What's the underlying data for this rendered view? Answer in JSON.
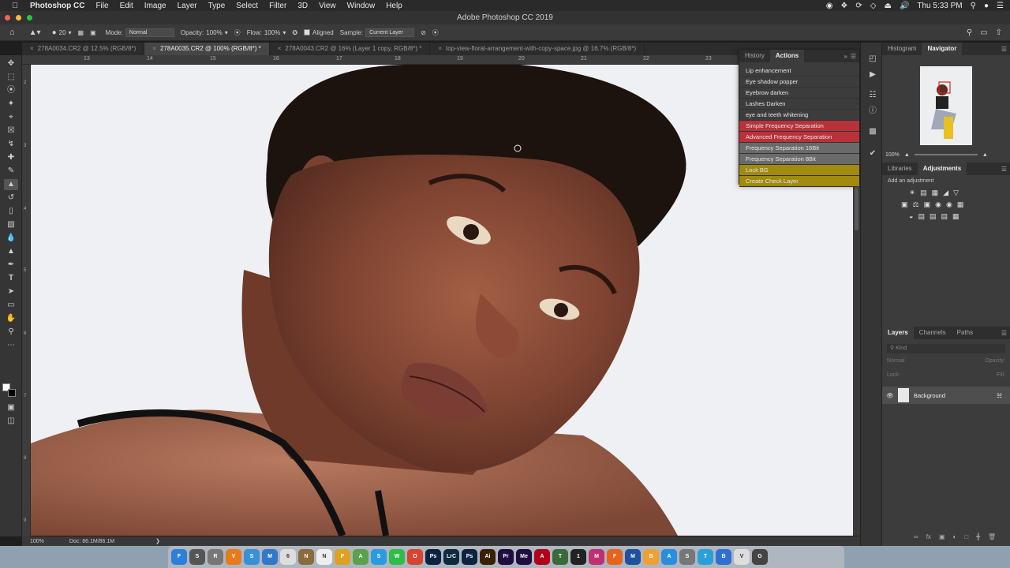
{
  "menubar": {
    "app_name": "Photoshop CC",
    "items": [
      "File",
      "Edit",
      "Image",
      "Layer",
      "Type",
      "Select",
      "Filter",
      "3D",
      "View",
      "Window",
      "Help"
    ],
    "clock": "Thu 5:33 PM"
  },
  "window": {
    "title": "Adobe Photoshop CC 2019"
  },
  "options": {
    "brush_size": "20",
    "mode_label": "Mode:",
    "mode_value": "Normal",
    "opacity_label": "Opacity:",
    "opacity_value": "100%",
    "flow_label": "Flow:",
    "flow_value": "100%",
    "aligned_label": "Aligned",
    "sample_label": "Sample:",
    "sample_value": "Current Layer"
  },
  "doc_tabs": [
    {
      "label": "278A0034.CR2 @ 12.5% (RGB/8*)"
    },
    {
      "label": "278A0035.CR2 @ 100% (RGB/8*) *"
    },
    {
      "label": "278A0043.CR2 @ 16% (Layer 1 copy, RGB/8*) *"
    },
    {
      "label": "top-view-floral-arrangement-with-copy-space.jpg @ 16.7% (RGB/8*)"
    }
  ],
  "ruler_h": [
    "13",
    "14",
    "15",
    "16",
    "17",
    "18",
    "19",
    "20",
    "21",
    "22",
    "23"
  ],
  "ruler_v": [
    "2",
    "3",
    "4",
    "5",
    "6",
    "7",
    "8",
    "9",
    "0"
  ],
  "status": {
    "zoom": "100%",
    "doc": "Doc: 86.1M/86.1M"
  },
  "actions_panel": {
    "tabs": [
      "History",
      "Actions"
    ],
    "items": [
      {
        "label": "Lip enhancement",
        "color": ""
      },
      {
        "label": "Eye shadow popper",
        "color": ""
      },
      {
        "label": "Eyebrow darken",
        "color": ""
      },
      {
        "label": "Lashes Darken",
        "color": ""
      },
      {
        "label": "eye and teeth whitening",
        "color": ""
      },
      {
        "label": "Simple Frequency Separation",
        "color": "#b8323a"
      },
      {
        "label": "Advanced Frequency Separation",
        "color": "#b8323a"
      },
      {
        "label": "Frequency Separation 16Bit",
        "color": "#6a6a6a"
      },
      {
        "label": "Frequency Separation 8Bit",
        "color": "#6a6a6a"
      },
      {
        "label": "Lock BG",
        "color": "#a08a10"
      },
      {
        "label": "Create Check Layer",
        "color": "#a08a10"
      }
    ]
  },
  "navigator": {
    "tabs": [
      "Histogram",
      "Navigator"
    ],
    "zoom": "100%"
  },
  "adjustments": {
    "tabs": [
      "Libraries",
      "Adjustments"
    ],
    "hint": "Add an adjustment"
  },
  "layers": {
    "tabs": [
      "Layers",
      "Channels",
      "Paths"
    ],
    "kind": "Kind",
    "blend": "Normal",
    "opacity_label": "Opacity:",
    "lock_label": "Lock:",
    "fill_label": "Fill:",
    "items": [
      {
        "name": "Background"
      }
    ]
  },
  "dock": [
    {
      "label": "F",
      "color": "#2d7fd8"
    },
    {
      "label": "S",
      "color": "#555"
    },
    {
      "label": "R",
      "color": "#777"
    },
    {
      "label": "V",
      "color": "#e87a1c"
    },
    {
      "label": "S",
      "color": "#3a8fd9"
    },
    {
      "label": "M",
      "color": "#3477c9"
    },
    {
      "label": "6",
      "color": "#ddd"
    },
    {
      "label": "N",
      "color": "#8b6a3e"
    },
    {
      "label": "N",
      "color": "#eee"
    },
    {
      "label": "P",
      "color": "#e0a020"
    },
    {
      "label": "A",
      "color": "#5aa14a"
    },
    {
      "label": "S",
      "color": "#2a9be0"
    },
    {
      "label": "W",
      "color": "#2ebd4a"
    },
    {
      "label": "O",
      "color": "#d9432f"
    },
    {
      "label": "Ps",
      "color": "#0b2340"
    },
    {
      "label": "LrC",
      "color": "#0d2a40"
    },
    {
      "label": "Ps",
      "color": "#0b2340"
    },
    {
      "label": "Ai",
      "color": "#3a1f00"
    },
    {
      "label": "Pr",
      "color": "#1e0f3e"
    },
    {
      "label": "Me",
      "color": "#1e0f3e"
    },
    {
      "label": "A",
      "color": "#b3001a"
    },
    {
      "label": "T",
      "color": "#3a6a3a"
    },
    {
      "label": "1",
      "color": "#222"
    },
    {
      "label": "M",
      "color": "#c03070"
    },
    {
      "label": "F",
      "color": "#e8631c"
    },
    {
      "label": "M",
      "color": "#2050a0"
    },
    {
      "label": "B",
      "color": "#f0a030"
    },
    {
      "label": "A",
      "color": "#2a8de0"
    },
    {
      "label": "S",
      "color": "#777"
    },
    {
      "label": "T",
      "color": "#2aa0d8"
    },
    {
      "label": "B",
      "color": "#3070d0"
    },
    {
      "label": "V",
      "color": "#ddd"
    },
    {
      "label": "G",
      "color": "#444"
    }
  ]
}
